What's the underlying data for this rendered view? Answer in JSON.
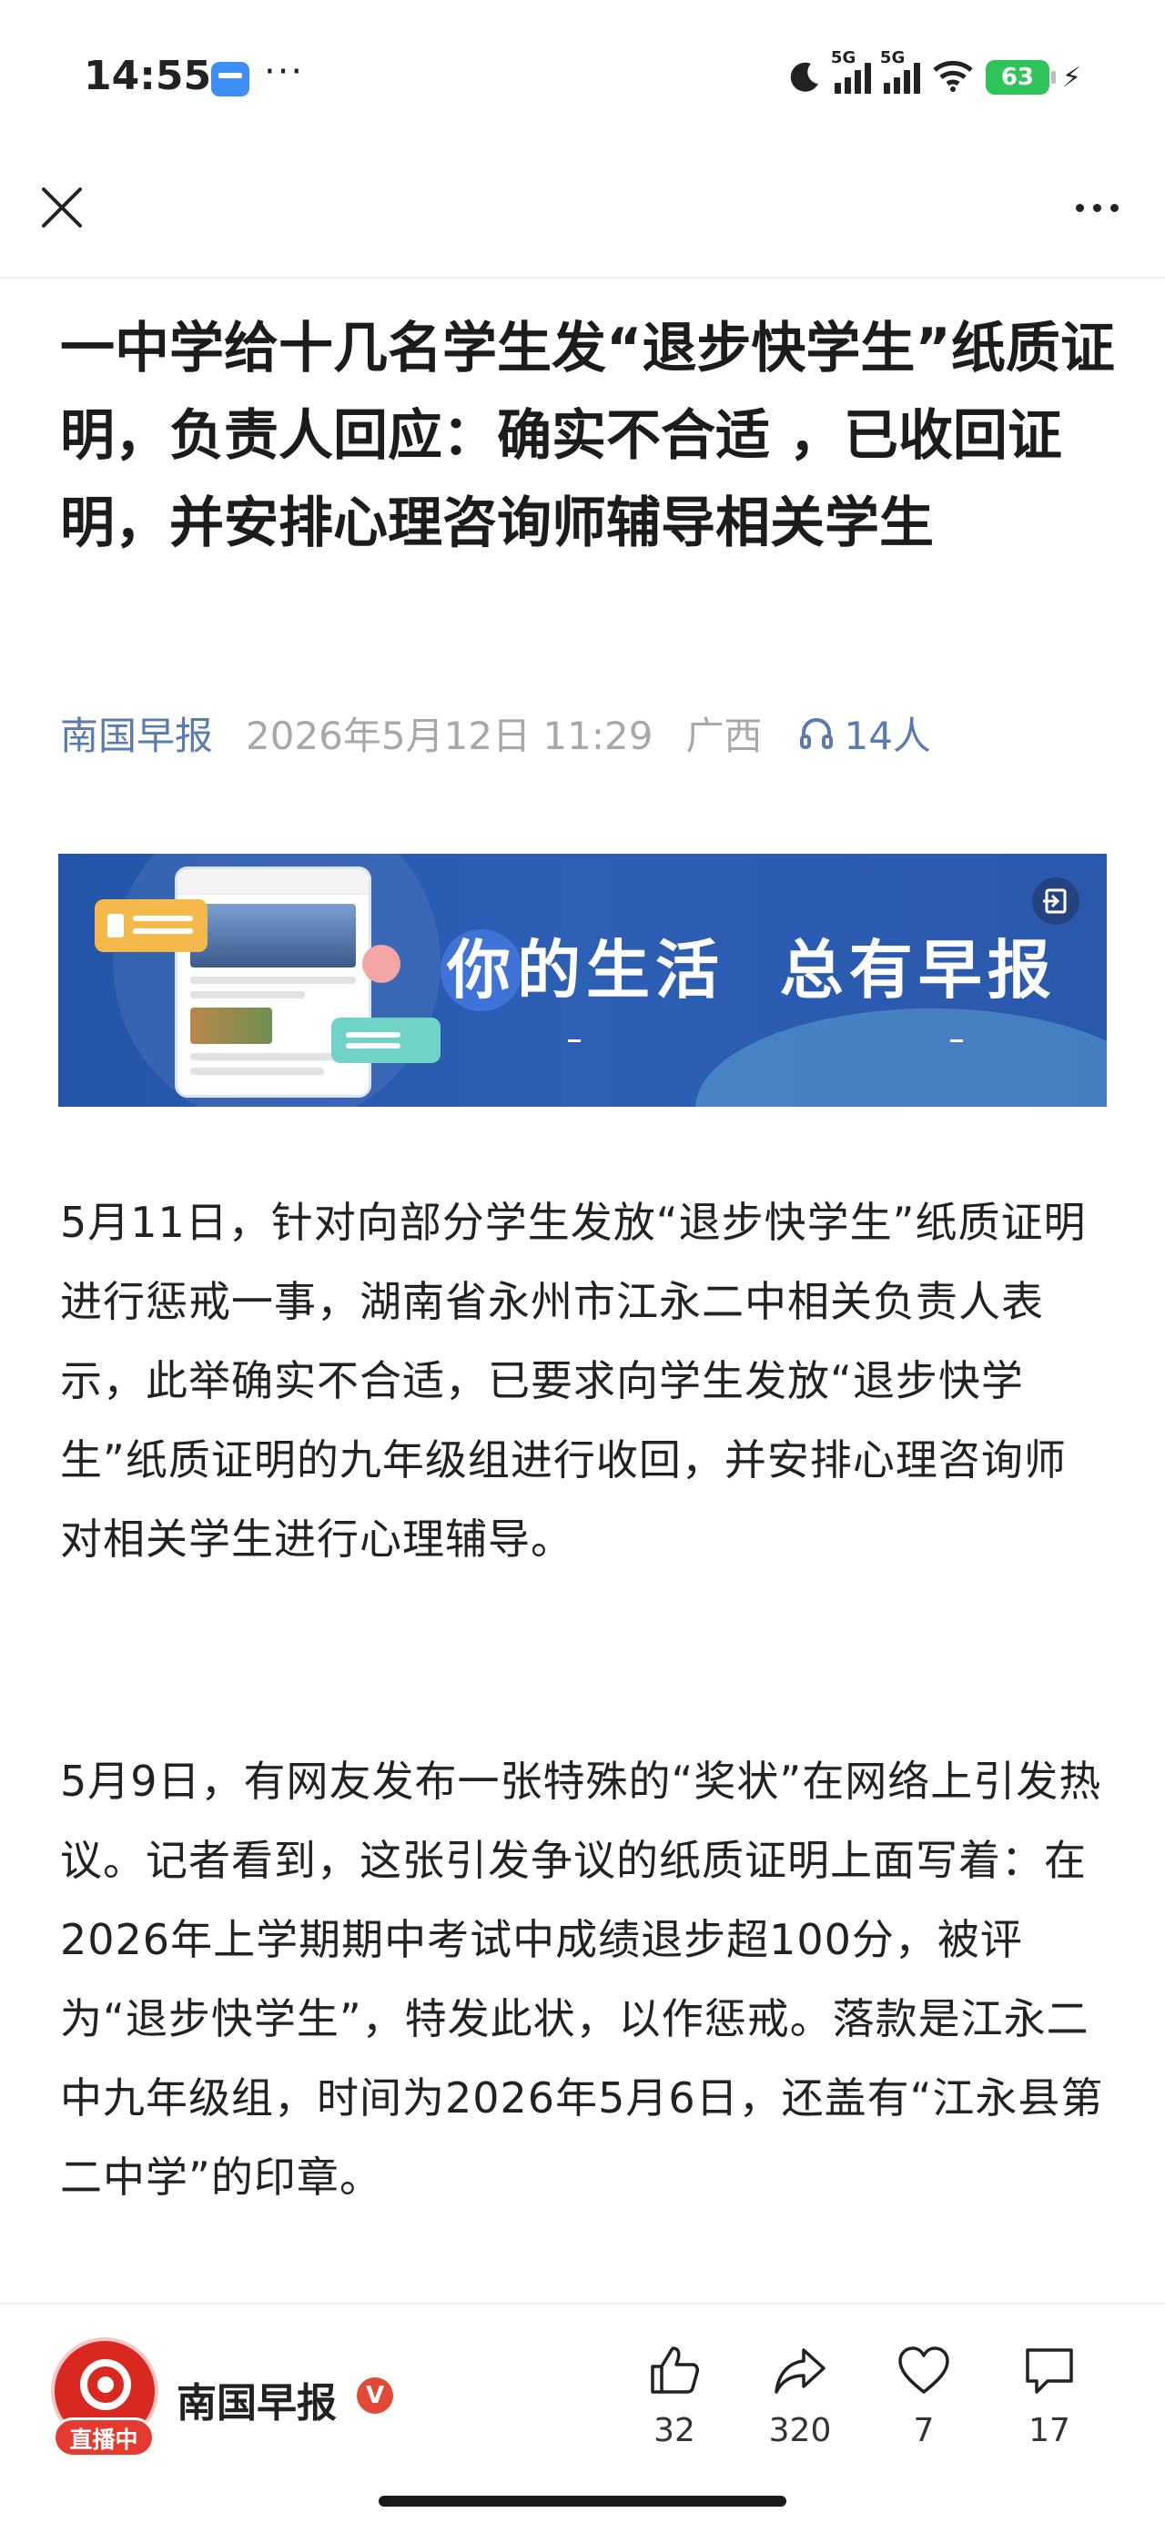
{
  "status_bar": {
    "time": "14:55",
    "dots": "···",
    "signal_1": "5G",
    "signal_2": "5G",
    "battery": "63"
  },
  "nav": {
    "close_icon": "close-icon",
    "more_icon": "more-icon"
  },
  "article": {
    "title": "一中学给十几名学生发“退步快学生”纸质证明，负责人回应：确实不合适 ，已收回证明，并安排心理咨询师辅导相关学生",
    "source": "南国早报",
    "date": "2026年5月12日 11:29",
    "region": "广西",
    "listeners": "14人",
    "banner_text": "你的生活  总有早报",
    "paragraphs": [
      "5月11日，针对向部分学生发放“退步快学生”纸质证明进行惩戒一事，湖南省永州市江永二中相关负责人表示，此举确实不合适，已要求向学生发放“退步快学生”纸质证明的九年级组进行收回，并安排心理咨询师对相关学生进行心理辅导。",
      "5月9日，有网友发布一张特殊的“奖状”在网络上引发热议。记者看到，这张引发争议的纸质证明上面写着：在2026年上学期期中考试中成绩退步超100分，被评为“退步快学生”，特发此状，以作惩戒。落款是江永二中九年级组，时间为2026年5月6日，还盖有“江永县第二中学”的印章。"
    ]
  },
  "bottom_bar": {
    "author": "南国早报",
    "live_label": "直播中",
    "verified": "V",
    "likes": "32",
    "shares": "320",
    "favorites": "7",
    "comments": "17"
  },
  "colors": {
    "source_blue": "#5a7bb0",
    "meta_gray": "#a8a8a8",
    "banner_blue": "#2455a8",
    "battery_green": "#2fc45a",
    "brand_red": "#d8281f"
  }
}
